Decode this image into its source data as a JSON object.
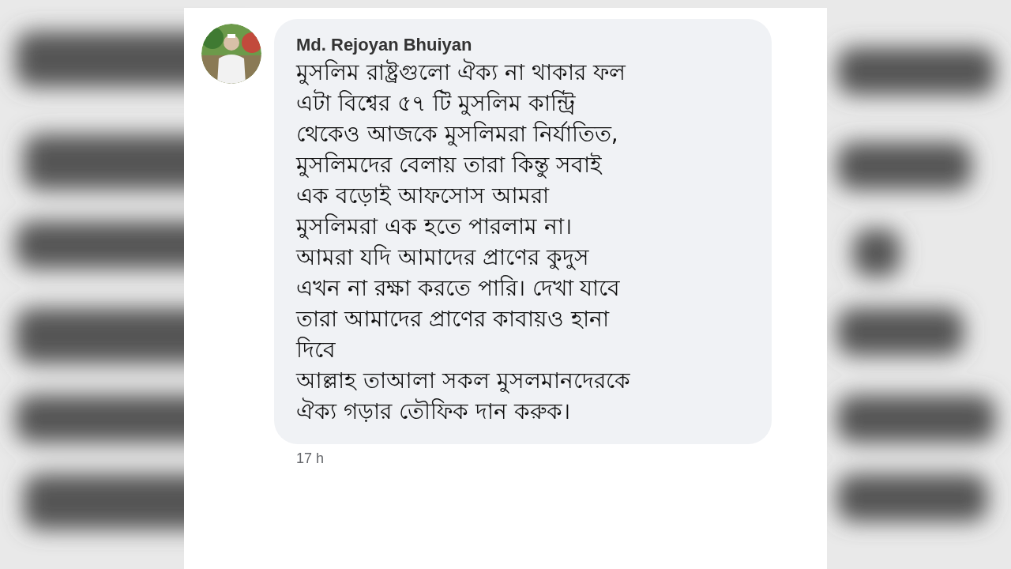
{
  "comment": {
    "author": "Md. Rejoyan Bhuiyan",
    "lines": [
      "মুসলিম রাষ্ট্রগুলো ঐক্য না থাকার ফল",
      "এটা বিশ্বের ৫৭ টি মুসলিম কান্ট্রি",
      "থেকেও আজকে মুসলিমরা নির্যাতিত,",
      "মুসলিমদের বেলায় তারা কিন্তু সবাই",
      "এক বড়োই আফসোস আমরা",
      "মুসলিমরা এক হতে পারলাম না।",
      "আমরা যদি আমাদের প্রাণের কুদুস",
      "এখন না রক্ষা করতে পারি। দেখা যাবে",
      "তারা আমাদের প্রাণের কাবায়ও হানা",
      "দিবে",
      "আল্লাহ তাআলা সকল মুসলমানদেরকে",
      "ঐক্য গড়ার তৌফিক দান করুক।"
    ],
    "time": "17 h"
  }
}
